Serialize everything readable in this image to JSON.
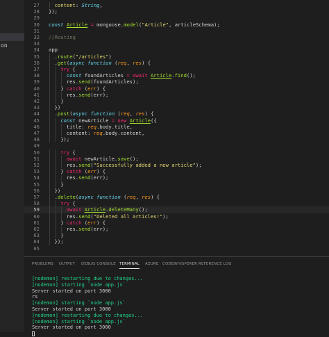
{
  "sidebar": {
    "items": [
      {
        "label": "",
        "active": false
      },
      {
        "label": "",
        "active": false
      },
      {
        "label": "",
        "active": true
      },
      {
        "label": "on",
        "active": false
      },
      {
        "label": "",
        "active": false
      }
    ]
  },
  "editor": {
    "current_line": "59",
    "lines": [
      {
        "n": "27",
        "indent": 1,
        "tokens": [
          [
            "prop",
            "content"
          ],
          [
            "p",
            ": "
          ],
          [
            "ty",
            "String"
          ],
          [
            "p",
            ","
          ]
        ]
      },
      {
        "n": "28",
        "indent": 0,
        "tokens": [
          [
            "p",
            "});"
          ]
        ]
      },
      {
        "n": "29",
        "indent": 0,
        "tokens": []
      },
      {
        "n": "30",
        "indent": 0,
        "tokens": [
          [
            "kw",
            "const "
          ],
          [
            "cls",
            "Article"
          ],
          [
            "op",
            " = "
          ],
          [
            "p",
            "mongoose."
          ],
          [
            "fn",
            "model"
          ],
          [
            "p",
            "("
          ],
          [
            "str",
            "\"Article\""
          ],
          [
            "p",
            ", articleSchema);"
          ]
        ]
      },
      {
        "n": "31",
        "indent": 0,
        "tokens": []
      },
      {
        "n": "32",
        "indent": 0,
        "tokens": [
          [
            "cm",
            "//Routing"
          ]
        ]
      },
      {
        "n": "33",
        "indent": 0,
        "tokens": []
      },
      {
        "n": "34",
        "indent": 0,
        "tokens": [
          [
            "p",
            "app"
          ]
        ]
      },
      {
        "n": "35",
        "indent": 1,
        "tokens": [
          [
            "p",
            "."
          ],
          [
            "fn",
            "route"
          ],
          [
            "p",
            "("
          ],
          [
            "str",
            "\"/articles\""
          ],
          [
            "p",
            ")"
          ]
        ]
      },
      {
        "n": "36",
        "indent": 1,
        "tokens": [
          [
            "p",
            "."
          ],
          [
            "fn",
            "get"
          ],
          [
            "p",
            "("
          ],
          [
            "kw",
            "async function "
          ],
          [
            "p",
            "("
          ],
          [
            "param",
            "req"
          ],
          [
            "p",
            ", "
          ],
          [
            "param",
            "res"
          ],
          [
            "p",
            ") {"
          ]
        ]
      },
      {
        "n": "37",
        "indent": 2,
        "tokens": [
          [
            "op",
            "try"
          ],
          [
            "p",
            " {"
          ]
        ]
      },
      {
        "n": "38",
        "indent": 3,
        "tokens": [
          [
            "kw",
            "const "
          ],
          [
            "p",
            "foundArticles "
          ],
          [
            "op",
            "= await "
          ],
          [
            "cls",
            "Article"
          ],
          [
            "p",
            "."
          ],
          [
            "fn",
            "find"
          ],
          [
            "p",
            "();"
          ]
        ]
      },
      {
        "n": "39",
        "indent": 3,
        "tokens": [
          [
            "p",
            "res."
          ],
          [
            "fn",
            "send"
          ],
          [
            "p",
            "(foundArticles);"
          ]
        ]
      },
      {
        "n": "40",
        "indent": 2,
        "tokens": [
          [
            "p",
            "} "
          ],
          [
            "op",
            "catch"
          ],
          [
            "p",
            " ("
          ],
          [
            "param",
            "err"
          ],
          [
            "p",
            ") {"
          ]
        ]
      },
      {
        "n": "41",
        "indent": 3,
        "tokens": [
          [
            "p",
            "res."
          ],
          [
            "fn",
            "send"
          ],
          [
            "p",
            "(err);"
          ]
        ]
      },
      {
        "n": "42",
        "indent": 2,
        "tokens": [
          [
            "p",
            "}"
          ]
        ]
      },
      {
        "n": "43",
        "indent": 1,
        "tokens": [
          [
            "p",
            "})"
          ]
        ]
      },
      {
        "n": "44",
        "indent": 1,
        "tokens": [
          [
            "p",
            "."
          ],
          [
            "fn",
            "post"
          ],
          [
            "p",
            "("
          ],
          [
            "kw",
            "async function "
          ],
          [
            "p",
            "("
          ],
          [
            "param",
            "req"
          ],
          [
            "p",
            ", "
          ],
          [
            "param",
            "res"
          ],
          [
            "p",
            ") {"
          ]
        ]
      },
      {
        "n": "45",
        "indent": 2,
        "tokens": [
          [
            "kw",
            "const "
          ],
          [
            "p",
            "newArticle "
          ],
          [
            "op",
            "= new "
          ],
          [
            "cls",
            "Article"
          ],
          [
            "p",
            "({"
          ]
        ]
      },
      {
        "n": "46",
        "indent": 3,
        "tokens": [
          [
            "p",
            "title: "
          ],
          [
            "param",
            "req"
          ],
          [
            "p",
            ".body.title,"
          ]
        ]
      },
      {
        "n": "47",
        "indent": 3,
        "tokens": [
          [
            "p",
            "content: "
          ],
          [
            "param",
            "req"
          ],
          [
            "p",
            ".body.content,"
          ]
        ]
      },
      {
        "n": "48",
        "indent": 2,
        "tokens": [
          [
            "p",
            "});"
          ]
        ]
      },
      {
        "n": "49",
        "indent": 0,
        "tokens": []
      },
      {
        "n": "50",
        "indent": 2,
        "tokens": [
          [
            "op",
            "try"
          ],
          [
            "p",
            " {"
          ]
        ]
      },
      {
        "n": "51",
        "indent": 3,
        "tokens": [
          [
            "op",
            "await "
          ],
          [
            "p",
            "newArticle."
          ],
          [
            "fn",
            "save"
          ],
          [
            "p",
            "();"
          ]
        ]
      },
      {
        "n": "52",
        "indent": 3,
        "tokens": [
          [
            "p",
            "res."
          ],
          [
            "fn",
            "send"
          ],
          [
            "p",
            "("
          ],
          [
            "str",
            "\"Successfully added a new article\""
          ],
          [
            "p",
            ");"
          ]
        ]
      },
      {
        "n": "53",
        "indent": 2,
        "tokens": [
          [
            "p",
            "} "
          ],
          [
            "op",
            "catch"
          ],
          [
            "p",
            " ("
          ],
          [
            "param",
            "err"
          ],
          [
            "p",
            ") {"
          ]
        ]
      },
      {
        "n": "54",
        "indent": 3,
        "tokens": [
          [
            "p",
            "res."
          ],
          [
            "fn",
            "send"
          ],
          [
            "p",
            "(err);"
          ]
        ]
      },
      {
        "n": "55",
        "indent": 2,
        "tokens": [
          [
            "p",
            "}"
          ]
        ]
      },
      {
        "n": "56",
        "indent": 1,
        "tokens": [
          [
            "p",
            "})"
          ]
        ]
      },
      {
        "n": "57",
        "indent": 1,
        "tokens": [
          [
            "p",
            "."
          ],
          [
            "fn",
            "delete"
          ],
          [
            "p",
            "("
          ],
          [
            "kw",
            "async function "
          ],
          [
            "p",
            "("
          ],
          [
            "param",
            "req"
          ],
          [
            "p",
            ", "
          ],
          [
            "param",
            "res"
          ],
          [
            "p",
            ") {"
          ]
        ]
      },
      {
        "n": "58",
        "indent": 2,
        "tokens": [
          [
            "op",
            "try"
          ],
          [
            "p",
            " {"
          ]
        ]
      },
      {
        "n": "59",
        "indent": 3,
        "tokens": [
          [
            "op",
            "await "
          ],
          [
            "cls",
            "Article"
          ],
          [
            "p",
            "."
          ],
          [
            "fn",
            "deleteMany"
          ],
          [
            "p",
            "();"
          ]
        ]
      },
      {
        "n": "60",
        "indent": 3,
        "tokens": [
          [
            "p",
            "res."
          ],
          [
            "fn",
            "send"
          ],
          [
            "p",
            "("
          ],
          [
            "str",
            "\"Deleted all articles!\""
          ],
          [
            "p",
            ");"
          ]
        ]
      },
      {
        "n": "61",
        "indent": 2,
        "tokens": [
          [
            "p",
            "} "
          ],
          [
            "op",
            "catch"
          ],
          [
            "p",
            " ("
          ],
          [
            "param",
            "err"
          ],
          [
            "p",
            ") {"
          ]
        ]
      },
      {
        "n": "62",
        "indent": 3,
        "tokens": [
          [
            "p",
            "res."
          ],
          [
            "fn",
            "send"
          ],
          [
            "p",
            "(err);"
          ]
        ]
      },
      {
        "n": "63",
        "indent": 2,
        "tokens": [
          [
            "p",
            "}"
          ]
        ]
      },
      {
        "n": "64",
        "indent": 1,
        "tokens": [
          [
            "p",
            "});"
          ]
        ]
      },
      {
        "n": "65",
        "indent": 0,
        "tokens": []
      }
    ]
  },
  "panel": {
    "tabs": [
      {
        "label": "PROBLEMS",
        "active": false
      },
      {
        "label": "OUTPUT",
        "active": false
      },
      {
        "label": "DEBUG CONSOLE",
        "active": false
      },
      {
        "label": "TERMINAL",
        "active": true
      },
      {
        "label": "AZURE",
        "active": false
      },
      {
        "label": "CODEWHISPERER REFERENCE LOG",
        "active": false
      }
    ],
    "terminal_lines": [
      {
        "text": "[nodemon] restarting due to changes...",
        "style": "green"
      },
      {
        "text": "[nodemon] starting `node app.js`",
        "style": "green"
      },
      {
        "text": "Server started on port 3000",
        "style": "plain"
      },
      {
        "text": "rs",
        "style": "plain"
      },
      {
        "text": "[nodemon] starting `node app.js`",
        "style": "green"
      },
      {
        "text": "Server started on port 3000",
        "style": "plain"
      },
      {
        "text": "[nodemon] restarting due to changes...",
        "style": "green"
      },
      {
        "text": "[nodemon] starting `node app.js`",
        "style": "green"
      },
      {
        "text": "Server started on port 3000",
        "style": "plain"
      }
    ]
  },
  "colors": {
    "background": "#1e1e1e",
    "keyword": "#66d9ef",
    "function": "#a6e22e",
    "string": "#e6db74",
    "operator": "#f92672",
    "comment": "#75715e",
    "param": "#fd971f",
    "terminal_green": "#23d18b"
  }
}
